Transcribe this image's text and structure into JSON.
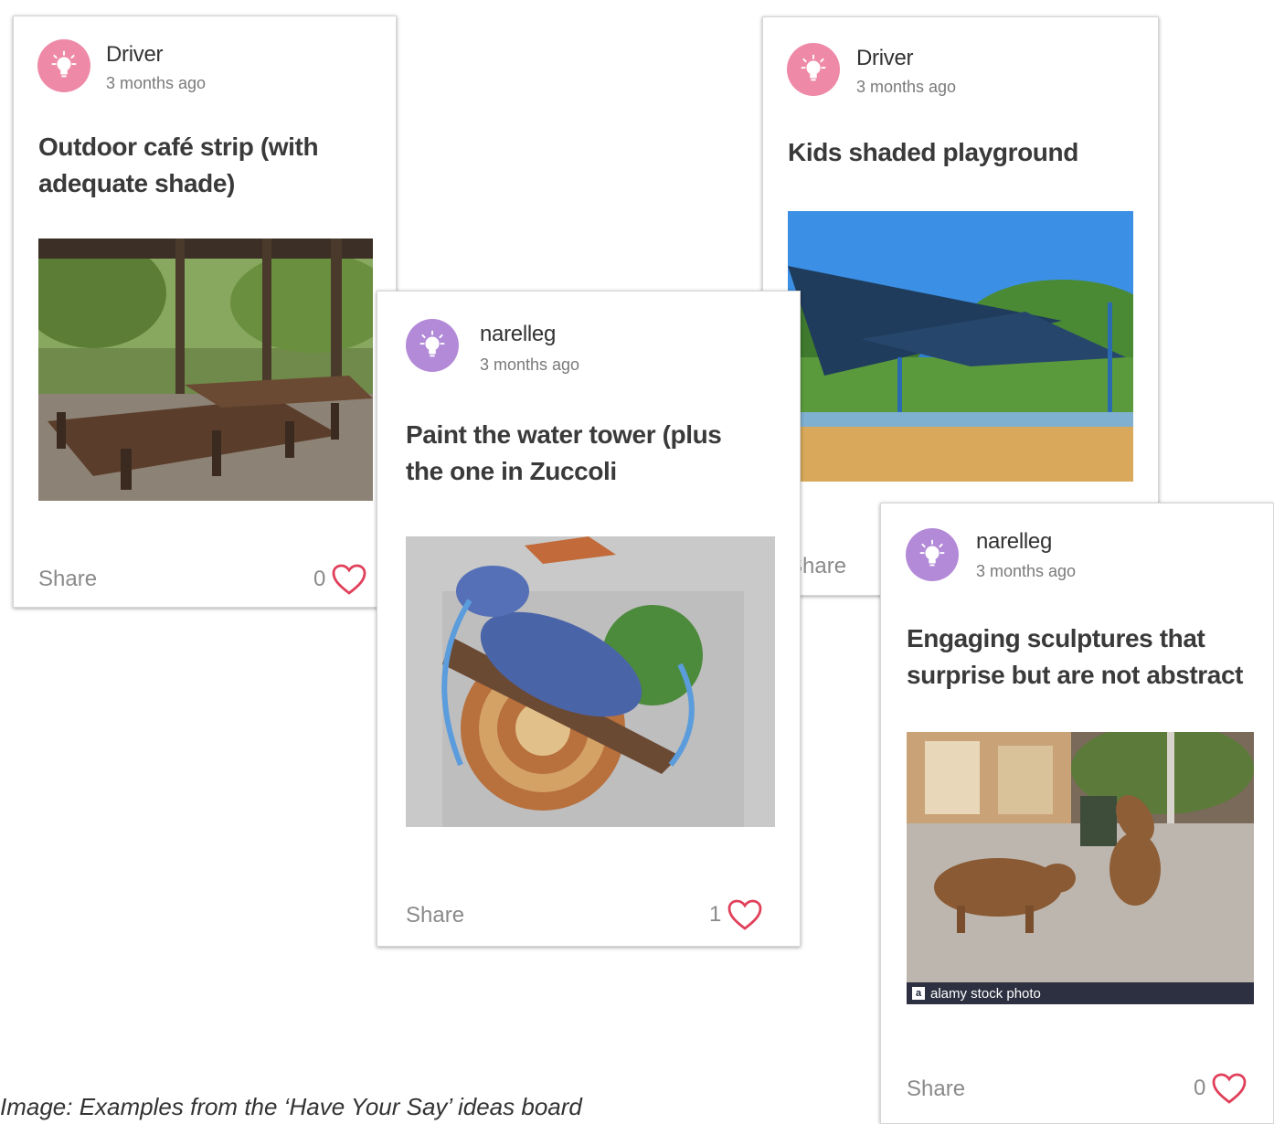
{
  "caption": "Image: Examples from the ‘Have Your Say’ ideas board",
  "colors": {
    "avatar_pink": "#ee8aa8",
    "avatar_purple": "#b38ad8",
    "heart": "#e0405a"
  },
  "cards": [
    {
      "author": "Driver",
      "time": "3 months ago",
      "title_line1": "Outdoor café strip (with",
      "title_line2": "adequate shade)",
      "photo": "outdoor-cafe-photo",
      "share": "Share",
      "likes": "0"
    },
    {
      "author": "narelleg",
      "time": "3 months ago",
      "title_line1": "Paint the water tower (plus",
      "title_line2": "the one in Zuccoli",
      "photo": "water-tower-mural-photo",
      "share": "Share",
      "likes": "1"
    },
    {
      "author": "Driver",
      "time": "3 months ago",
      "title_line1": "Kids shaded playground",
      "photo": "shaded-playground-photo",
      "share": "Share"
    },
    {
      "author": "narelleg",
      "time": "3 months ago",
      "title_line1": "Engaging sculptures that",
      "title_line2": "surprise but are not abstract",
      "photo": "pig-sculptures-photo",
      "photo_watermark": "alamy stock photo",
      "share": "Share",
      "likes": "0"
    }
  ]
}
